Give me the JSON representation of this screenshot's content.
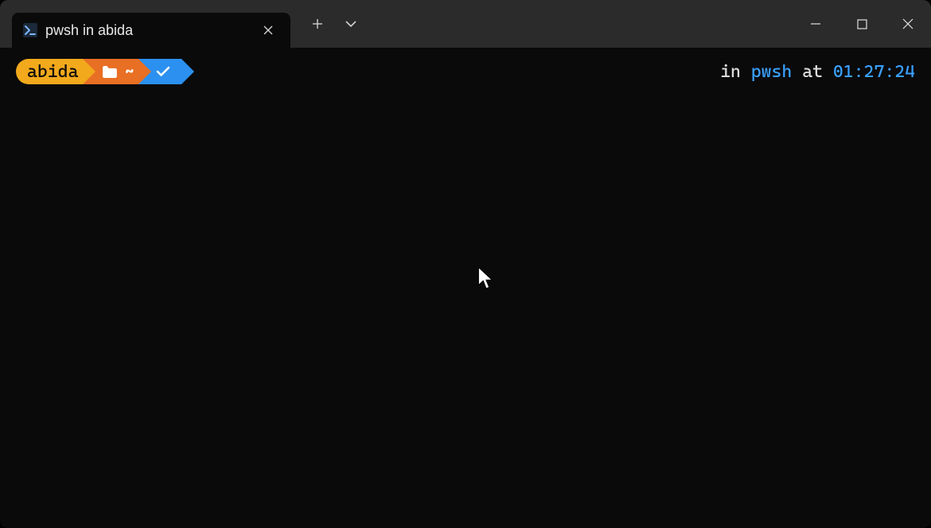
{
  "window": {
    "tab_title": "pwsh in abida"
  },
  "prompt": {
    "user": "abida",
    "path_glyph": "~",
    "status_prefix": "in ",
    "shell": "pwsh",
    "status_mid": " at ",
    "time": "01:27:24"
  },
  "icons": {
    "tab": "powershell-icon",
    "tab_close": "close-icon",
    "new_tab": "plus-icon",
    "dropdown": "chevron-down-icon",
    "minimize": "minimize-icon",
    "maximize": "maximize-icon",
    "win_close": "close-icon",
    "folder": "folder-icon",
    "check": "check-icon",
    "cursor": "cursor-icon"
  }
}
